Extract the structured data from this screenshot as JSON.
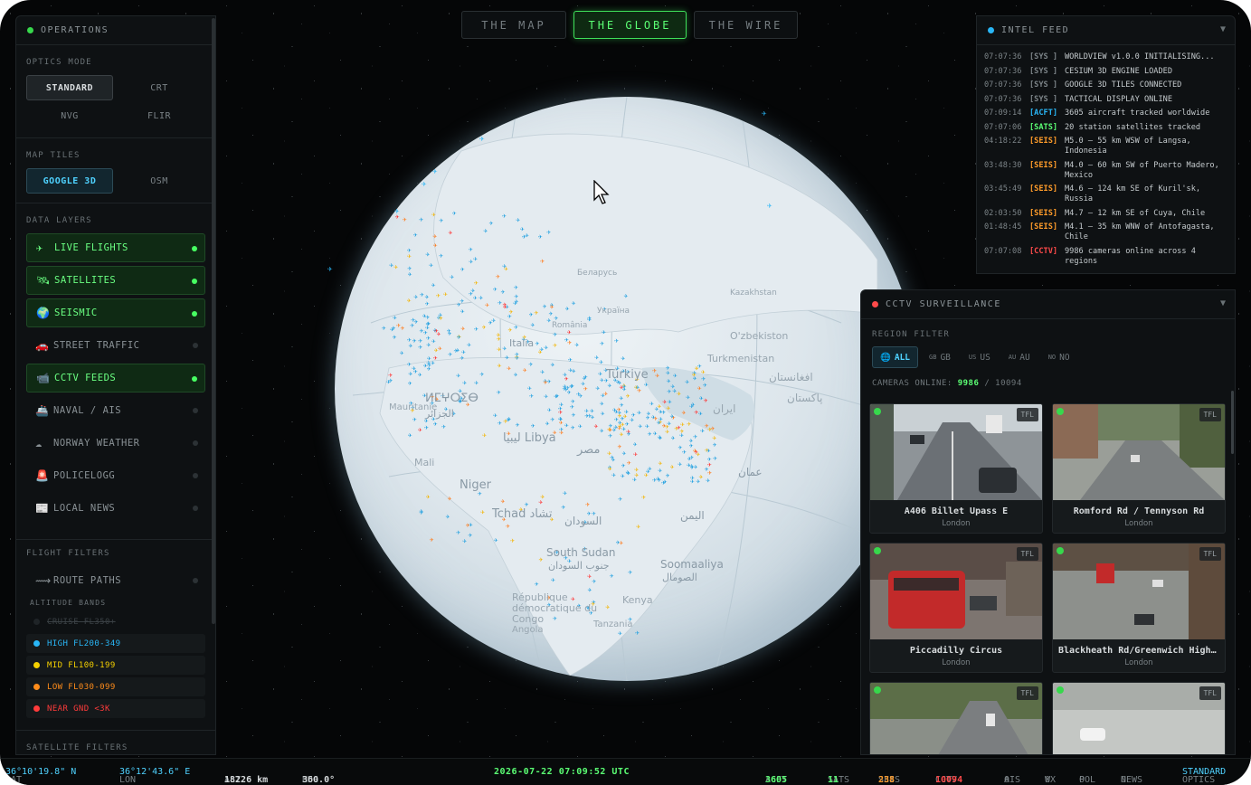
{
  "tabs": [
    {
      "label": "THE MAP",
      "active": false
    },
    {
      "label": "THE GLOBE",
      "active": true
    },
    {
      "label": "THE WIRE",
      "active": false
    }
  ],
  "operations": {
    "title": "OPERATIONS",
    "optics_label": "OPTICS MODE",
    "optics": [
      "STANDARD",
      "CRT",
      "NVG",
      "FLIR"
    ],
    "optics_selected": "STANDARD",
    "tiles_label": "MAP TILES",
    "tiles": [
      "GOOGLE 3D",
      "OSM"
    ],
    "tiles_selected": "GOOGLE 3D",
    "layers_label": "DATA LAYERS",
    "layers": [
      {
        "label": "LIVE FLIGHTS",
        "on": true,
        "icon": "airplane-icon"
      },
      {
        "label": "SATELLITES",
        "on": true,
        "icon": "satellite-icon"
      },
      {
        "label": "SEISMIC",
        "on": true,
        "icon": "globe-icon"
      },
      {
        "label": "STREET TRAFFIC",
        "on": false,
        "icon": "car-icon"
      },
      {
        "label": "CCTV FEEDS",
        "on": true,
        "icon": "camera-icon"
      },
      {
        "label": "NAVAL / AIS",
        "on": false,
        "icon": "ship-icon"
      },
      {
        "label": "NORWAY WEATHER",
        "on": false,
        "icon": "cloud-icon"
      },
      {
        "label": "POLICELOGG",
        "on": false,
        "icon": "siren-icon"
      },
      {
        "label": "LOCAL NEWS",
        "on": false,
        "icon": "newspaper-icon"
      }
    ],
    "flight_filters_label": "FLIGHT FILTERS",
    "route_paths": "ROUTE PATHS",
    "altitude_label": "ALTITUDE BANDS",
    "bands": [
      {
        "label": "CRUISE FL350+",
        "color": "#2a2f32",
        "disabled": true
      },
      {
        "label": "HIGH FL200-349",
        "color": "#29b6f6",
        "disabled": false
      },
      {
        "label": "MID FL100-199",
        "color": "#f5d000",
        "disabled": false
      },
      {
        "label": "LOW FL030-099",
        "color": "#ff8c1a",
        "disabled": false
      },
      {
        "label": "NEAR GND <3K",
        "color": "#ff3b3b",
        "disabled": false
      }
    ],
    "sat_filters_label": "SATELLITE FILTERS"
  },
  "intel": {
    "title": "INTEL FEED",
    "entries": [
      {
        "time": "07:07:36",
        "tag": "[SYS ]",
        "kind": "sys",
        "msg": "WORLDVIEW v1.0.0 INITIALISING..."
      },
      {
        "time": "07:07:36",
        "tag": "[SYS ]",
        "kind": "sys",
        "msg": "CESIUM 3D ENGINE LOADED"
      },
      {
        "time": "07:07:36",
        "tag": "[SYS ]",
        "kind": "sys",
        "msg": "GOOGLE 3D TILES CONNECTED"
      },
      {
        "time": "07:07:36",
        "tag": "[SYS ]",
        "kind": "sys",
        "msg": "TACTICAL DISPLAY ONLINE"
      },
      {
        "time": "07:09:14",
        "tag": "[ACFT]",
        "kind": "acft",
        "msg": "3605 aircraft tracked worldwide"
      },
      {
        "time": "07:07:06",
        "tag": "[SATS]",
        "kind": "sats",
        "msg": "20 station satellites tracked"
      },
      {
        "time": "04:18:22",
        "tag": "[SEIS]",
        "kind": "seis",
        "msg": "M5.0 — 55 km WSW of Langsa, Indonesia"
      },
      {
        "time": "03:48:30",
        "tag": "[SEIS]",
        "kind": "seis",
        "msg": "M4.0 — 60 km SW of Puerto Madero, Mexico"
      },
      {
        "time": "03:45:49",
        "tag": "[SEIS]",
        "kind": "seis",
        "msg": "M4.6 — 124 km SE of Kuril'sk, Russia"
      },
      {
        "time": "02:03:50",
        "tag": "[SEIS]",
        "kind": "seis",
        "msg": "M4.7 — 12 km SE of Cuya, Chile"
      },
      {
        "time": "01:48:45",
        "tag": "[SEIS]",
        "kind": "seis",
        "msg": "M4.1 — 35 km WNW of Antofagasta, Chile"
      },
      {
        "time": "07:07:08",
        "tag": "[CCTV]",
        "kind": "cctv",
        "msg": "9986 cameras online across 4 regions"
      }
    ]
  },
  "cctv": {
    "title": "CCTV SURVEILLANCE",
    "region_label": "REGION FILTER",
    "regions": [
      {
        "code": "",
        "label": "ALL",
        "selected": true
      },
      {
        "code": "GB",
        "label": "GB",
        "selected": false
      },
      {
        "code": "US",
        "label": "US",
        "selected": false
      },
      {
        "code": "AU",
        "label": "AU",
        "selected": false
      },
      {
        "code": "NO",
        "label": "NO",
        "selected": false
      }
    ],
    "online_label": "CAMERAS ONLINE:",
    "online": "9986",
    "total": "/ 10094",
    "badge": "TFL",
    "cams": [
      {
        "name": "A406 Billet Upass E",
        "city": "London"
      },
      {
        "name": "Romford Rd / Tennyson Rd",
        "city": "London"
      },
      {
        "name": "Piccadilly Circus",
        "city": "London"
      },
      {
        "name": "Blackheath Rd/Greenwich High Rd",
        "city": "London"
      },
      {
        "name": "",
        "city": ""
      },
      {
        "name": "",
        "city": ""
      }
    ]
  },
  "globe_labels": {
    "belarus": "Беларусь",
    "ukraine": "Україна",
    "kazakhstan": "Kazakhstan",
    "romania": "România",
    "italia": "Italia",
    "turkiye": "Türkiye",
    "uzbekistan": "O'zbekiston",
    "turkmenistan": "Turkmenistan",
    "afghanistan": "افغانستان",
    "pakistan": "پاکستان",
    "iran": "ایران",
    "morocco": "ⵍⵎⵖⵔⵉⴱ",
    "algeria": "الجزائر",
    "mauritanie": "Mauritanie",
    "libya": "ليبيا Libya",
    "misr": "مصر",
    "mali": "Mali",
    "niger": "Niger",
    "tchad": "Tchad تشاد",
    "sudan": "السودان",
    "yemen": "اليمن",
    "oman": "عمان",
    "south_sudan": "South Sudan",
    "south_sudan_ar": "جنوب السودان",
    "somalia": "Soomaaliya",
    "somalia_ar": "الصومال",
    "congo": "République démocratique du Congo",
    "tanzania": "Tanzania",
    "angola": "Angola",
    "kenya": "Kenya"
  },
  "status": {
    "lat_label": "LAT",
    "lat": "36°10'19.8\" N",
    "lon_label": "LON",
    "lon": "36°12'43.6\" E",
    "alt_label": "ALT",
    "alt": "18226 km",
    "hdg_label": "HDG",
    "hdg": "360.0°",
    "clock": "2026-07-22 07:09:52 UTC",
    "acft_label": "ACFT",
    "acft": "3605",
    "sats_label": "SATS",
    "sats": "11",
    "seis_label": "SEIS",
    "seis": "238",
    "cctv_label": "CCTV",
    "cctv": "10094",
    "ais_label": "AIS",
    "ais": "0",
    "wx_label": "WX",
    "wx": "0",
    "pol_label": "POL",
    "pol": "0",
    "news_label": "NEWS",
    "news": "0",
    "optics_label": "OPTICS",
    "optics": "STANDARD"
  },
  "colors": {
    "accent_green": "#5bff74",
    "accent_cyan": "#4fd2ff",
    "seis_orange": "#ff9c2a",
    "cctv_red": "#ff4a4a"
  }
}
